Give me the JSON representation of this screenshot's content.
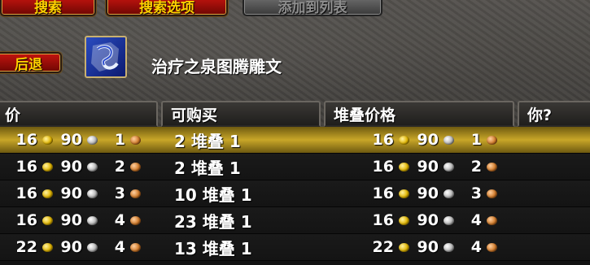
{
  "buttons": {
    "search": "搜索",
    "search_options": "搜索选项",
    "add_to_list": "添加到列表",
    "back": "后退"
  },
  "item": {
    "name": "治疗之泉图腾雕文",
    "icon": "glyph-scroll-icon"
  },
  "columns": {
    "price": "价",
    "available": "可购买",
    "stack_price": "堆叠价格",
    "you": "你?"
  },
  "rows": [
    {
      "unit": {
        "gold": "16",
        "silver": "90",
        "copper": "1"
      },
      "available": "2 堆叠 1",
      "stack": {
        "gold": "16",
        "silver": "90",
        "copper": "1"
      },
      "selected": true
    },
    {
      "unit": {
        "gold": "16",
        "silver": "90",
        "copper": "2"
      },
      "available": "2 堆叠 1",
      "stack": {
        "gold": "16",
        "silver": "90",
        "copper": "2"
      }
    },
    {
      "unit": {
        "gold": "16",
        "silver": "90",
        "copper": "3"
      },
      "available": "10 堆叠 1",
      "stack": {
        "gold": "16",
        "silver": "90",
        "copper": "3"
      }
    },
    {
      "unit": {
        "gold": "16",
        "silver": "90",
        "copper": "4"
      },
      "available": "23 堆叠 1",
      "stack": {
        "gold": "16",
        "silver": "90",
        "copper": "4"
      }
    },
    {
      "unit": {
        "gold": "22",
        "silver": "90",
        "copper": "4"
      },
      "available": "13 堆叠 1",
      "stack": {
        "gold": "22",
        "silver": "90",
        "copper": "4"
      }
    }
  ],
  "colors": {
    "button_red": "#c4140f",
    "button_text": "#ffd100",
    "selected_row": "#c8a628"
  }
}
